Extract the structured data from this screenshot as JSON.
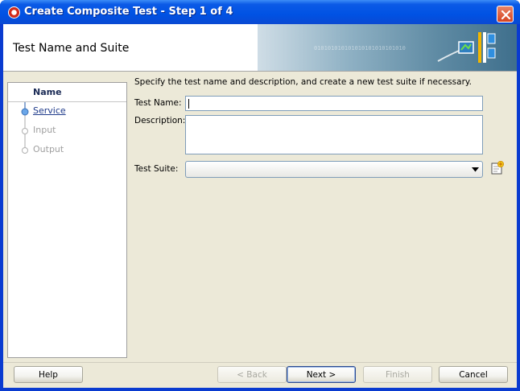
{
  "window": {
    "title": "Create Composite Test - Step 1 of 4",
    "app_icon": "oracle-jdeveloper-icon",
    "close_icon": "close-icon"
  },
  "header": {
    "title": "Test Name and Suite",
    "banner_text": "010101010101010101010101010",
    "banner_icon": "composite-test-icon"
  },
  "steps": [
    {
      "label": "Name",
      "state": "current"
    },
    {
      "label": "Service",
      "state": "link"
    },
    {
      "label": "Input",
      "state": "disabled"
    },
    {
      "label": "Output",
      "state": "disabled"
    }
  ],
  "form": {
    "intro": "Specify the test name and description, and create a new test suite if necessary.",
    "test_name_label": "Test Name:",
    "test_name_value": "",
    "description_label": "Description:",
    "description_value": "",
    "test_suite_label": "Test Suite:",
    "test_suite_value": "",
    "new_suite_icon": "new-suite-icon"
  },
  "buttons": {
    "help": "Help",
    "back": "< Back",
    "next": "Next >",
    "finish": "Finish",
    "cancel": "Cancel"
  },
  "colors": {
    "titlebar": "#0052e4",
    "dialog_bg": "#ece9d8",
    "step_link": "#1e3a8a"
  }
}
